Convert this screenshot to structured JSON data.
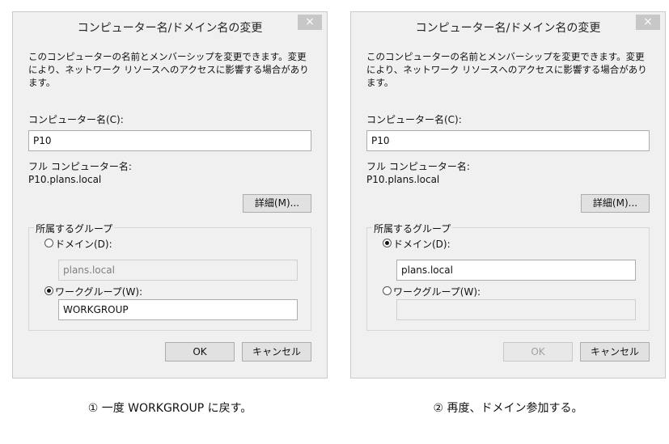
{
  "dialog1": {
    "title": "コンピューター名/ドメイン名の変更",
    "close": "×",
    "description": "このコンピューターの名前とメンバーシップを変更できます。変更により、ネットワーク リソースへのアクセスに影響する場合があります。",
    "computer_name_label": "コンピューター名(C):",
    "computer_name_value": "P10",
    "full_name_label": "フル コンピューター名:",
    "full_name_value": "P10.plans.local",
    "details_button": "詳細(M)...",
    "membership_label": "所属するグループ",
    "domain_label": "ドメイン(D):",
    "domain_value": "plans.local",
    "domain_selected": false,
    "workgroup_label": "ワークグループ(W):",
    "workgroup_value": "WORKGROUP",
    "workgroup_selected": true,
    "ok_button": "OK",
    "cancel_button": "キャンセル"
  },
  "dialog2": {
    "title": "コンピューター名/ドメイン名の変更",
    "close": "×",
    "description": "このコンピューターの名前とメンバーシップを変更できます。変更により、ネットワーク リソースへのアクセスに影響する場合があります。",
    "computer_name_label": "コンピューター名(C):",
    "computer_name_value": "P10",
    "full_name_label": "フル コンピューター名:",
    "full_name_value": "P10.plans.local",
    "details_button": "詳細(M)...",
    "membership_label": "所属するグループ",
    "domain_label": "ドメイン(D):",
    "domain_value": "plans.local",
    "domain_selected": true,
    "workgroup_label": "ワークグループ(W):",
    "workgroup_value": "",
    "workgroup_selected": false,
    "ok_button": "OK",
    "cancel_button": "キャンセル"
  },
  "captions": {
    "left": "① 一度 WORKGROUP に戻す。",
    "right": "② 再度、ドメイン参加する。"
  }
}
